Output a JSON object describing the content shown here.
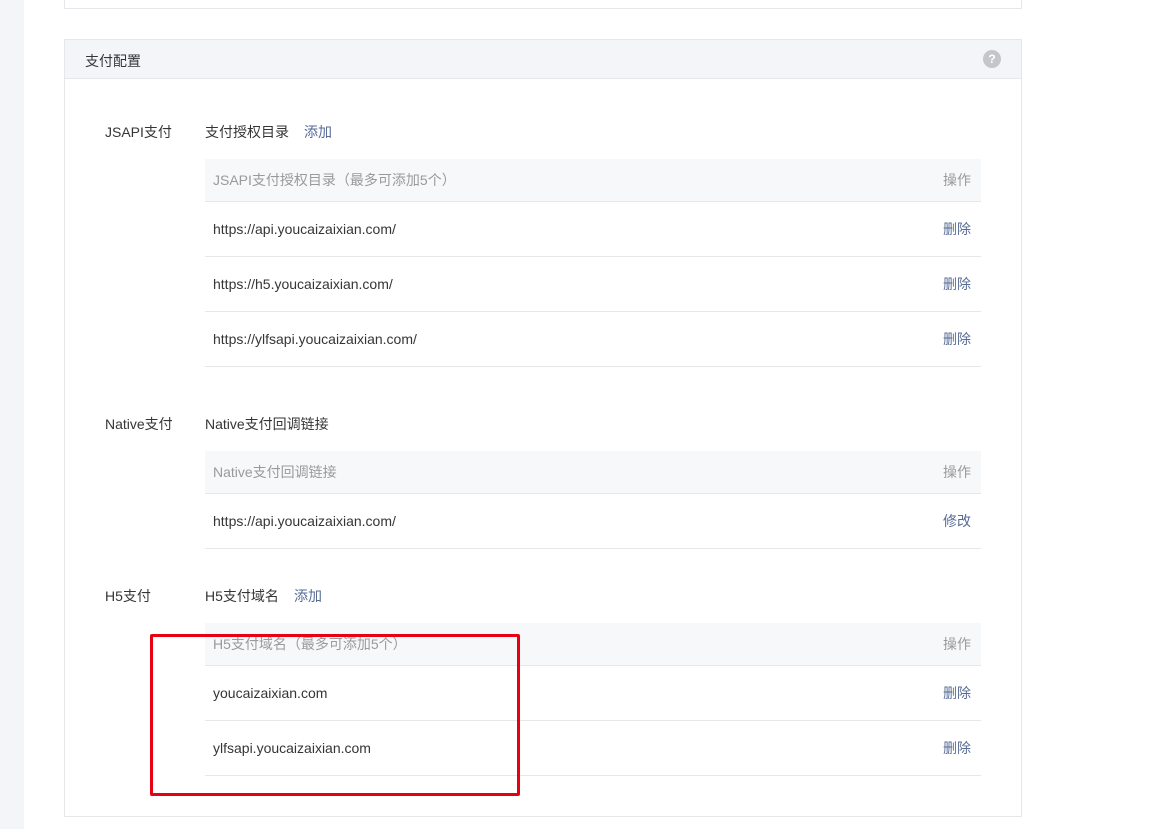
{
  "panel": {
    "title": "支付配置"
  },
  "jsapi": {
    "label": "JSAPI支付",
    "subtitle": "支付授权目录",
    "add_label": "添加",
    "table": {
      "header": "JSAPI支付授权目录（最多可添加5个）",
      "action_header": "操作",
      "rows": [
        {
          "value": "https://api.youcaizaixian.com/",
          "action": "删除"
        },
        {
          "value": "https://h5.youcaizaixian.com/",
          "action": "删除"
        },
        {
          "value": "https://ylfsapi.youcaizaixian.com/",
          "action": "删除"
        }
      ]
    }
  },
  "native": {
    "label": "Native支付",
    "subtitle": "Native支付回调链接",
    "table": {
      "header": "Native支付回调链接",
      "action_header": "操作",
      "rows": [
        {
          "value": "https://api.youcaizaixian.com/",
          "action": "修改"
        }
      ]
    }
  },
  "h5": {
    "label": "H5支付",
    "subtitle": "H5支付域名",
    "add_label": "添加",
    "table": {
      "header": "H5支付域名（最多可添加5个）",
      "action_header": "操作",
      "rows": [
        {
          "value": "youcaizaixian.com",
          "action": "删除"
        },
        {
          "value": "ylfsapi.youcaizaixian.com",
          "action": "删除"
        }
      ]
    }
  },
  "colors": {
    "link": "#576b95",
    "highlight": "#e60012"
  }
}
